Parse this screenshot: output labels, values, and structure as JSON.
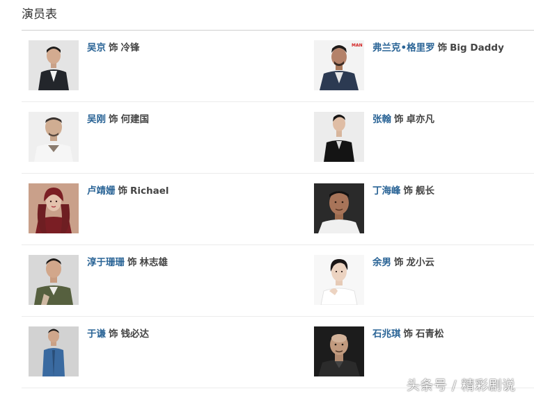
{
  "page": {
    "title": "演员表"
  },
  "cast": [
    {
      "actor": "吴京",
      "sep": "饰",
      "role": "冷锋",
      "photo": "wujing-photo"
    },
    {
      "actor": "弗兰克•格里罗",
      "sep": "饰",
      "role": "Big Daddy",
      "photo": "frank-grillo-photo"
    },
    {
      "actor": "吴刚",
      "sep": "饰",
      "role": "何建国",
      "photo": "wugang-photo"
    },
    {
      "actor": "张翰",
      "sep": "饰",
      "role": "卓亦凡",
      "photo": "zhanghan-photo"
    },
    {
      "actor": "卢靖姗",
      "sep": "饰",
      "role": "Richael",
      "photo": "lujingshan-photo"
    },
    {
      "actor": "丁海峰",
      "sep": "饰",
      "role": "舰长",
      "photo": "dinghaifeng-photo"
    },
    {
      "actor": "淳于珊珊",
      "sep": "饰",
      "role": "林志雄",
      "photo": "chunyushanshan-photo"
    },
    {
      "actor": "余男",
      "sep": "饰",
      "role": "龙小云",
      "photo": "yunan-photo"
    },
    {
      "actor": "于谦",
      "sep": "饰",
      "role": "钱必达",
      "photo": "yuqian-photo"
    },
    {
      "actor": "石兆琪",
      "sep": "饰",
      "role": "石青松",
      "photo": "shizhaoqi-photo"
    }
  ],
  "photo_badge": "MAN",
  "watermark": "头条号 / 精彩剧说",
  "colors": {
    "actor_link": "#2a6496",
    "text": "#444444",
    "divider": "#ebebeb"
  }
}
